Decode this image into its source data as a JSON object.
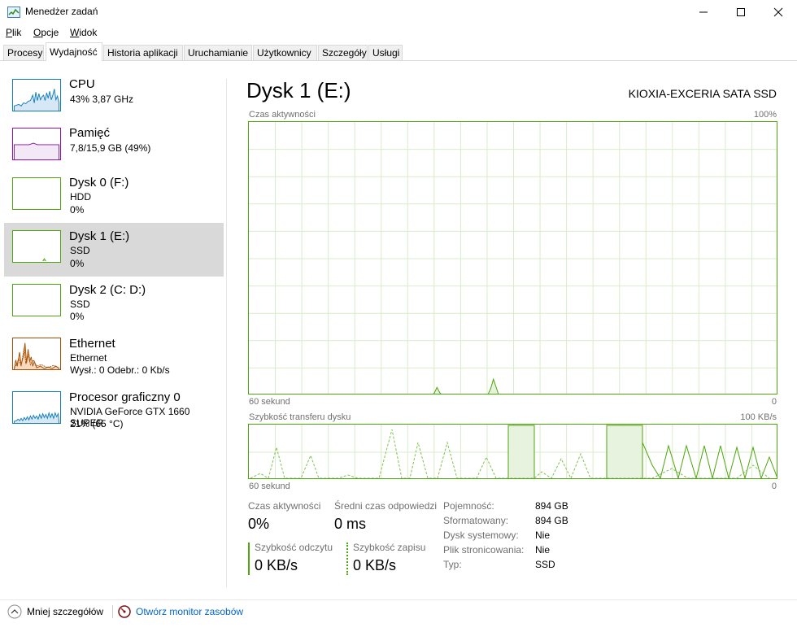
{
  "window": {
    "title": "Menedżer zadań",
    "minimize_icon": "minimize-icon",
    "maximize_icon": "maximize-icon",
    "close_icon": "close-icon"
  },
  "menu": [
    {
      "label": "Plik",
      "accel": "P",
      "rest": "lik"
    },
    {
      "label": "Opcje",
      "accel": "O",
      "rest": "pcje"
    },
    {
      "label": "Widok",
      "accel": "W",
      "rest": "idok"
    }
  ],
  "tabs": [
    "Procesy",
    "Wydajność",
    "Historia aplikacji",
    "Uruchamianie",
    "Użytkownicy",
    "Szczegóły",
    "Usługi"
  ],
  "active_tab": "Wydajność",
  "sidebar": [
    {
      "title": "CPU",
      "line1": "43% 3,87 GHz",
      "line2": "",
      "color": "#117dbb",
      "fill": "#f1f6fa"
    },
    {
      "title": "Pamięć",
      "line1": "7,8/15,9 GB (49%)",
      "line2": "",
      "color": "#8b12ae",
      "fill": "#f4f2f4"
    },
    {
      "title": "Dysk 0 (F:)",
      "line1": "HDD",
      "line2": "0%",
      "color": "#4da60c",
      "fill": "#eff7e9"
    },
    {
      "title": "Dysk 1 (E:)",
      "line1": "SSD",
      "line2": "0%",
      "color": "#4da60c",
      "fill": "#eff7e9"
    },
    {
      "title": "Dysk 2 (C: D:)",
      "line1": "SSD",
      "line2": "0%",
      "color": "#4da60c",
      "fill": "#eff7e9"
    },
    {
      "title": "Ethernet",
      "line1": "Ethernet",
      "line2": "Wysł.: 0 Odebr.: 0 Kb/s",
      "color": "#a74f01",
      "fill": "#fcf3eb"
    },
    {
      "title": "Procesor graficzny 0",
      "line1": "NVIDIA GeForce GTX 1660 SUPER",
      "line2": "21% (65 °C)",
      "color": "#117dbb",
      "fill": "#f1f6fa"
    }
  ],
  "selected_item": "Dysk 1 (E:)",
  "main": {
    "title": "Dysk 1 (E:)",
    "model": "KIOXIA-EXCERIA SATA SSD",
    "chart1_label": "Czas aktywności",
    "chart1_max": "100%",
    "chart1_time": "60 sekund",
    "chart1_min": "0",
    "chart2_label": "Szybkość transferu dysku",
    "chart2_max": "100 KB/s",
    "chart2_time": "60 sekund",
    "chart2_min": "0"
  },
  "chart_data": [
    {
      "type": "area",
      "title": "Czas aktywności",
      "ylim": [
        0,
        100
      ],
      "unit": "%",
      "x_range": "60 sekund",
      "values": [
        0,
        0,
        0,
        0,
        0,
        0,
        0,
        0,
        0,
        0,
        0,
        0,
        0,
        0,
        0,
        0,
        0,
        0,
        0,
        0,
        0,
        0,
        0,
        0,
        0,
        0,
        0,
        0,
        0.2,
        0,
        0,
        0,
        0,
        0,
        0,
        0,
        0,
        0,
        0,
        0,
        0,
        0,
        0,
        0,
        0,
        0,
        0,
        0,
        0,
        0,
        0,
        0,
        0,
        0,
        0,
        0,
        0,
        0,
        0,
        0,
        0,
        0,
        0,
        0,
        0,
        0,
        0,
        0,
        0,
        0.8,
        2.9,
        1.0,
        0,
        0,
        0,
        0,
        0,
        0,
        0,
        0,
        0,
        0,
        0,
        0,
        0,
        0,
        0.2,
        0.3,
        0.3,
        0.3,
        2.5,
        5.9,
        3.0,
        0,
        0,
        0,
        0,
        0,
        0,
        0,
        0,
        0,
        0,
        0,
        0,
        0,
        0,
        0,
        0,
        0,
        0,
        0,
        0,
        0,
        0,
        0,
        0,
        0,
        0,
        0,
        0,
        0,
        0,
        0,
        0,
        0,
        0,
        0,
        0,
        0,
        0,
        0,
        0,
        0,
        0,
        0,
        0,
        0,
        0,
        0,
        0,
        0,
        0,
        0,
        0,
        0,
        0,
        0,
        0,
        0,
        0,
        0,
        0,
        0,
        0,
        0,
        0,
        0,
        0,
        0,
        0,
        0,
        0,
        0,
        0,
        0,
        0,
        0,
        0,
        0,
        0,
        0,
        0,
        0,
        0,
        0,
        0,
        0,
        0,
        0,
        0,
        0,
        0,
        0,
        0,
        0,
        0,
        0,
        0,
        0,
        0,
        0,
        0,
        0,
        0,
        0,
        0,
        0
      ]
    },
    {
      "type": "line",
      "title": "Szybkość transferu dysku",
      "ylim": [
        0,
        100
      ],
      "unit": "KB/s",
      "x_range": "60 sekund",
      "series": [
        {
          "name": "Szybkość odczytu",
          "style": "solid",
          "values": [
            0,
            0,
            0,
            0,
            0,
            0,
            0,
            0,
            0,
            0,
            0,
            0,
            0,
            0,
            0,
            0,
            0,
            0,
            0,
            0,
            0,
            0,
            0,
            0,
            0,
            0,
            0,
            0,
            0,
            0,
            0,
            0,
            0,
            0,
            0,
            0,
            0,
            0,
            0,
            0,
            0,
            0,
            0,
            0,
            0,
            0,
            0,
            0,
            0,
            0,
            0,
            0,
            0,
            0,
            0,
            0,
            0,
            0,
            0,
            0,
            0,
            0,
            0,
            0,
            0,
            0,
            0,
            0,
            0,
            0,
            0,
            0,
            0,
            0,
            0,
            0,
            0,
            0,
            0,
            0,
            0,
            0,
            0,
            0,
            0,
            0,
            0,
            0,
            0,
            0,
            0,
            0,
            0,
            0,
            0,
            0,
            0,
            0,
            0,
            0,
            0,
            0,
            0,
            0,
            0,
            0,
            0,
            0,
            0,
            0,
            0,
            0,
            0,
            0,
            0,
            0,
            0,
            0,
            0,
            0,
            0,
            0,
            0,
            0,
            0,
            0,
            0,
            0,
            0,
            0,
            0,
            0,
            0,
            0,
            0,
            0,
            0,
            0,
            0,
            0,
            0,
            0,
            0,
            0,
            0,
            0,
            0,
            0,
            0,
            0,
            0,
            0,
            0,
            0,
            0,
            0,
            0,
            0,
            0,
            0,
            0,
            0,
            0,
            0,
            0,
            0,
            0,
            0,
            0,
            0,
            0,
            0,
            0,
            0,
            0,
            0,
            0,
            0,
            0,
            0,
            0,
            0,
            0,
            0,
            0,
            0,
            0,
            0,
            0,
            0,
            0,
            0,
            0,
            0,
            0,
            0,
            0,
            0,
            0,
            0,
            0,
            0
          ]
        },
        {
          "name": "Szybkość zapisu",
          "style": "dashed",
          "values": [
            0,
            0,
            0,
            0,
            0,
            0,
            0,
            0,
            0,
            0,
            0,
            0,
            0,
            0,
            0,
            0,
            0,
            0,
            0,
            0,
            0,
            0,
            0,
            0,
            0,
            0,
            0,
            0,
            0,
            0,
            0,
            0,
            0,
            0,
            0,
            0,
            0,
            0,
            0,
            0,
            0,
            0,
            0,
            0,
            0,
            0,
            0,
            0,
            0,
            0,
            0,
            0,
            0,
            0,
            0,
            0,
            0,
            0,
            0,
            0,
            0,
            0,
            0,
            0,
            0,
            0,
            0,
            0,
            0,
            0,
            0,
            0,
            0,
            0,
            0,
            0,
            0,
            0,
            0,
            0,
            0,
            0,
            0,
            0,
            0,
            0,
            0,
            0,
            0,
            0,
            0,
            0,
            0,
            0,
            0,
            0,
            0,
            0,
            0,
            0,
            0,
            0,
            0,
            0,
            0,
            0,
            0,
            0,
            0,
            0,
            0,
            0,
            0,
            0,
            0,
            0,
            0,
            0,
            0,
            0,
            0,
            0,
            0,
            0,
            0,
            0,
            0,
            0,
            0,
            0,
            0,
            0,
            0,
            0,
            0,
            0,
            0,
            0,
            0,
            0,
            0,
            0,
            0,
            0,
            0,
            0,
            0,
            0,
            0,
            0,
            0,
            0,
            0,
            0,
            0,
            0,
            0,
            0,
            0,
            0,
            0,
            0,
            0,
            0,
            0,
            0,
            0,
            0,
            0,
            0,
            0,
            0,
            0,
            0,
            0,
            0,
            0,
            0,
            0,
            0,
            0,
            0,
            0,
            0,
            0,
            0,
            0,
            0,
            0,
            0,
            0,
            0,
            0,
            0,
            0,
            0,
            0,
            0,
            0,
            0,
            0,
            0
          ]
        }
      ]
    }
  ],
  "stats": {
    "active_label": "Czas aktywności",
    "active_val": "0%",
    "resp_label": "Średni czas odpowiedzi",
    "resp_val": "0 ms",
    "read_label": "Szybkość odczytu",
    "read_val": "0 KB/s",
    "write_label": "Szybkość zapisu",
    "write_val": "0 KB/s"
  },
  "props": [
    {
      "label": "Pojemność:",
      "value": "894 GB"
    },
    {
      "label": "Sformatowany:",
      "value": "894 GB"
    },
    {
      "label": "Dysk systemowy:",
      "value": "Nie"
    },
    {
      "label": "Plik stronicowania:",
      "value": "Nie"
    },
    {
      "label": "Typ:",
      "value": "SSD"
    }
  ],
  "footer": {
    "less_details": "Mniej szczegółów",
    "monitor": "Otwórz monitor zasobów"
  },
  "colors": {
    "disk": "#4da60c",
    "cpu": "#117dbb",
    "mem": "#8b12ae",
    "eth": "#a74f01",
    "link": "#0066cc",
    "selected": "#d9d9d9"
  }
}
